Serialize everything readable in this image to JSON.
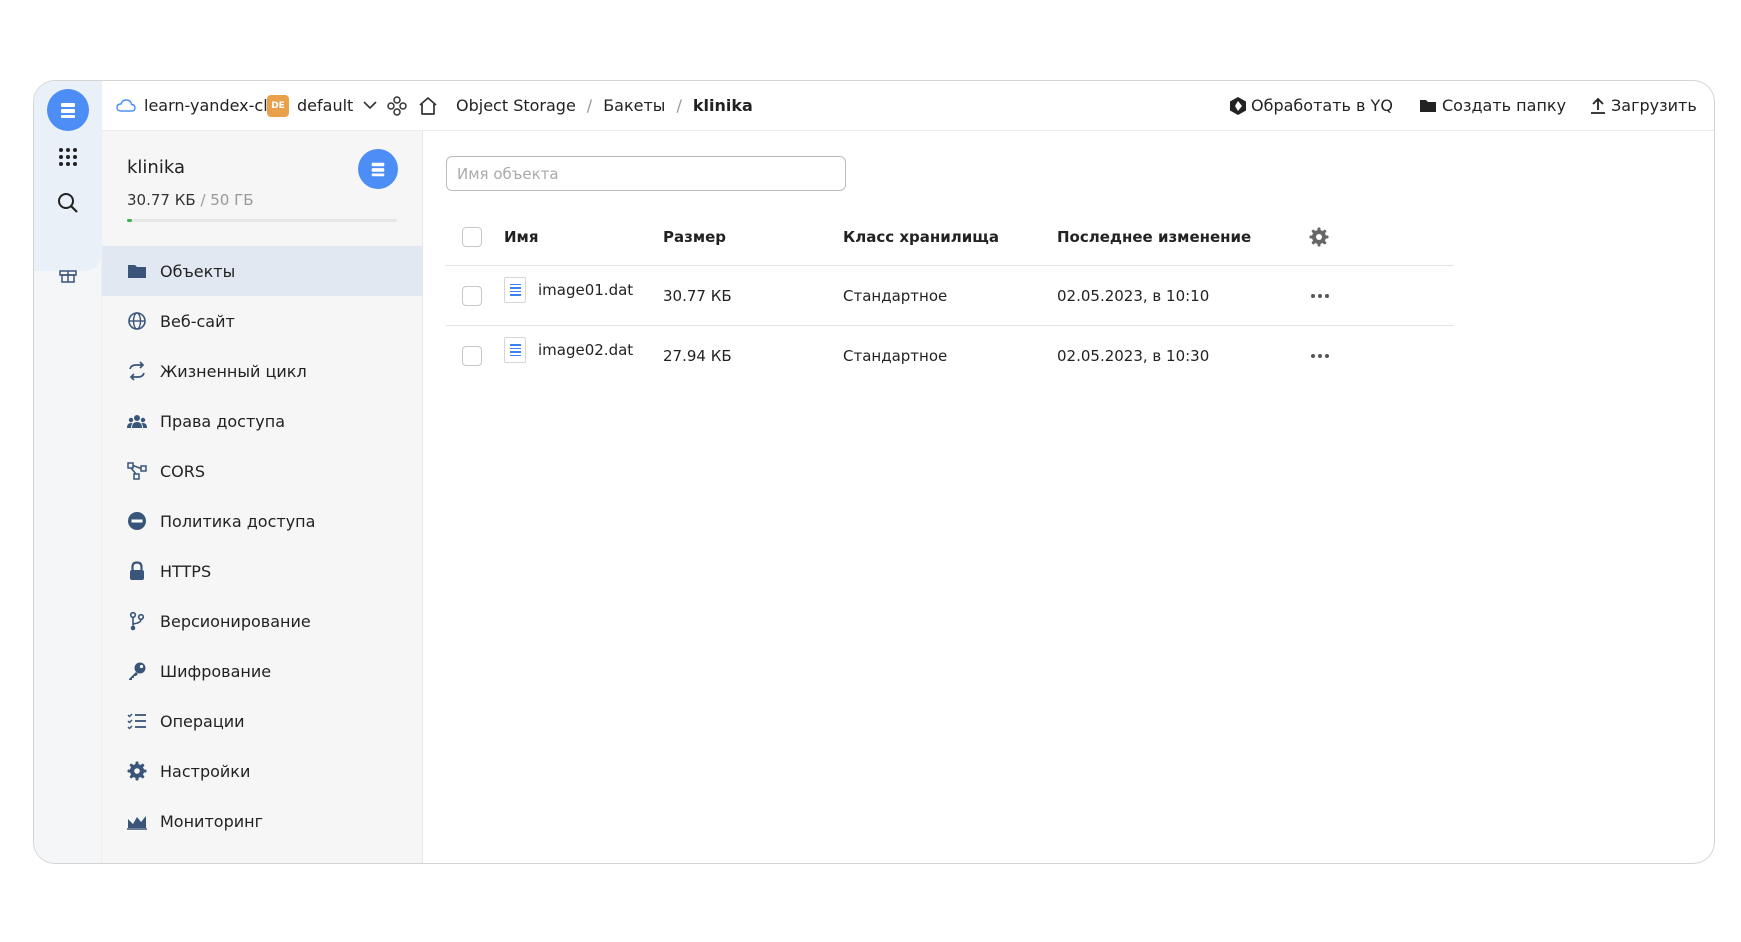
{
  "rail": {
    "logo_icon": "object-storage-icon",
    "items": [
      "apps-grid-icon",
      "search-icon",
      "gift-icon"
    ]
  },
  "topbar": {
    "cloud_name": "learn-yandex-cl...",
    "folder_badge": "DE",
    "folder_name": "default",
    "breadcrumbs": [
      "Object Storage",
      "Бакеты",
      "klinika"
    ],
    "separator": "/",
    "actions": {
      "yq": "Обработать в YQ",
      "create_folder": "Создать папку",
      "upload": "Загрузить"
    }
  },
  "sidebar": {
    "bucket_name": "klinika",
    "used": "30.77 КБ",
    "limit": "/ 50 ГБ",
    "usage_fraction": 6e-07,
    "items": [
      {
        "label": "Объекты",
        "icon": "folder-icon",
        "active": true
      },
      {
        "label": "Веб-сайт",
        "icon": "globe-icon"
      },
      {
        "label": "Жизненный цикл",
        "icon": "cycle-icon"
      },
      {
        "label": "Права доступа",
        "icon": "users-icon"
      },
      {
        "label": "CORS",
        "icon": "cors-icon"
      },
      {
        "label": "Политика доступа",
        "icon": "no-entry-icon"
      },
      {
        "label": "HTTPS",
        "icon": "lock-icon"
      },
      {
        "label": "Версионирование",
        "icon": "branch-icon"
      },
      {
        "label": "Шифрование",
        "icon": "key-icon"
      },
      {
        "label": "Операции",
        "icon": "list-check-icon"
      },
      {
        "label": "Настройки",
        "icon": "gear-icon"
      },
      {
        "label": "Мониторинг",
        "icon": "chart-icon"
      }
    ]
  },
  "main": {
    "search_placeholder": "Имя объекта",
    "columns": {
      "name": "Имя",
      "size": "Размер",
      "class": "Класс хранилища",
      "modified": "Последнее изменение"
    },
    "rows": [
      {
        "name": "image01.dat",
        "size": "30.77 КБ",
        "class": "Стандартное",
        "modified": "02.05.2023, в 10:10"
      },
      {
        "name": "image02.dat",
        "size": "27.94 КБ",
        "class": "Стандартное",
        "modified": "02.05.2023, в 10:30"
      }
    ]
  },
  "colors": {
    "accent": "#4c8df6",
    "folder_badge": "#e8a14a",
    "active_nav": "#e2e8f2",
    "usage_bar": "#3cb44b"
  }
}
